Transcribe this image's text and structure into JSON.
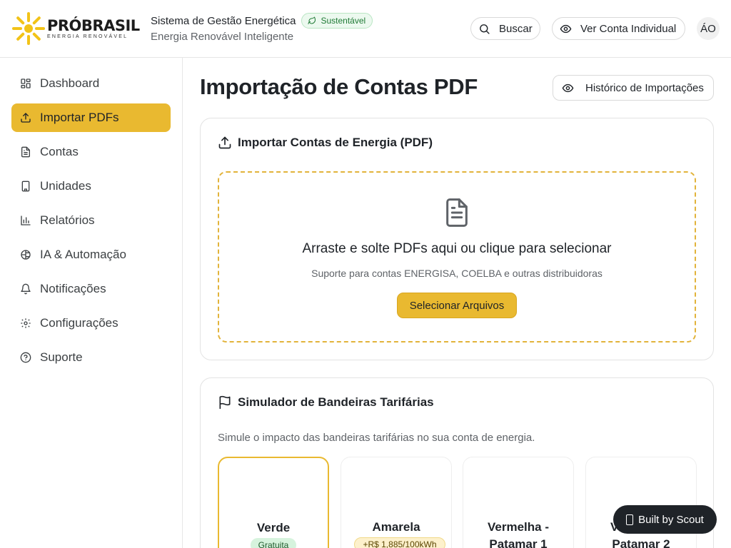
{
  "brand": {
    "logo_word": "PRÓBRASIL",
    "logo_tagline": "ENERGIA RENOVÁVEL"
  },
  "header": {
    "title": "Sistema de Gestão Energética",
    "badge": "Sustentável",
    "subtitle": "Energia Renovável Inteligente",
    "search_label": "Buscar",
    "account_label": "Ver Conta Individual",
    "avatar_initials": "ÁO"
  },
  "sidebar": {
    "items": [
      {
        "label": "Dashboard",
        "icon": "dashboard-icon"
      },
      {
        "label": "Importar PDFs",
        "icon": "upload-icon",
        "active": true
      },
      {
        "label": "Contas",
        "icon": "document-icon"
      },
      {
        "label": "Unidades",
        "icon": "building-icon"
      },
      {
        "label": "Relatórios",
        "icon": "bar-chart-icon"
      },
      {
        "label": "IA & Automação",
        "icon": "brain-icon"
      },
      {
        "label": "Notificações",
        "icon": "bell-icon"
      },
      {
        "label": "Configurações",
        "icon": "gear-icon"
      },
      {
        "label": "Suporte",
        "icon": "help-icon"
      }
    ]
  },
  "main": {
    "title": "Importação de Contas PDF",
    "history_label": "Histórico de Importações",
    "upload": {
      "title": "Importar Contas de Energia (PDF)",
      "drop_title": "Arraste e solte PDFs aqui ou clique para selecionar",
      "drop_subtitle": "Suporte para contas ENERGISA, COELBA e outras distribuidoras",
      "select_label": "Selecionar Arquivos"
    },
    "flags": {
      "title": "Simulador de Bandeiras Tarifárias",
      "description": "Simule o impacto das bandeiras tarifárias no sua conta de energia.",
      "options": [
        {
          "emoji": "",
          "name": "Verde",
          "pill": "Gratuita",
          "selected": true
        },
        {
          "emoji": "",
          "name": "Amarela",
          "pill": "+R$ 1,885/100kWh"
        },
        {
          "emoji": "",
          "name": "Vermelha - Patamar 1"
        },
        {
          "emoji": "",
          "name": "Vermelha - Patamar 2"
        }
      ]
    }
  },
  "scout": {
    "label": "Built by Scout"
  },
  "colors": {
    "accent": "#e9b930",
    "badge_green": "#1f7a35"
  }
}
